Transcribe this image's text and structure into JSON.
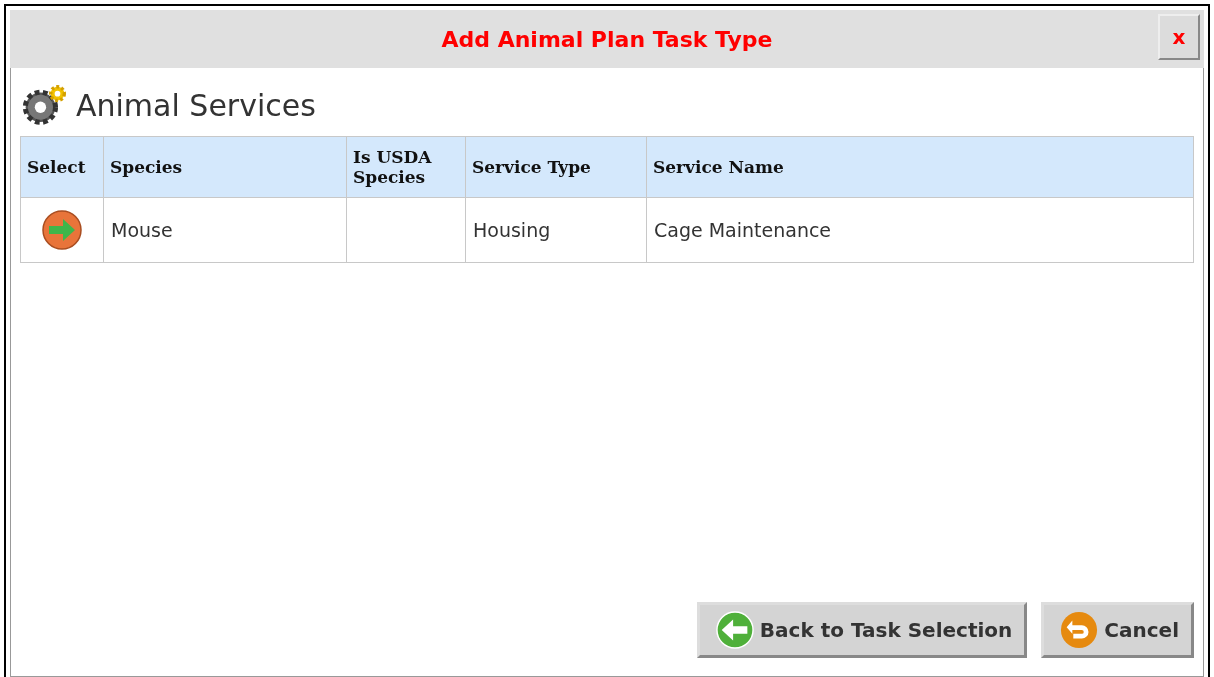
{
  "dialog": {
    "title": "Add Animal Plan Task Type",
    "close": "x"
  },
  "section": {
    "title": "Animal Services"
  },
  "table": {
    "columns": [
      "Select",
      "Species",
      "Is USDA Species",
      "Service Type",
      "Service Name"
    ],
    "rows": [
      {
        "species": "Mouse",
        "is_usda_species": "",
        "service_type": "Housing",
        "service_name": "Cage Maintenance"
      }
    ]
  },
  "buttons": [
    {
      "kind": "back",
      "label": "Back to Task Selection"
    },
    {
      "kind": "cancel",
      "label": "Cancel"
    }
  ]
}
